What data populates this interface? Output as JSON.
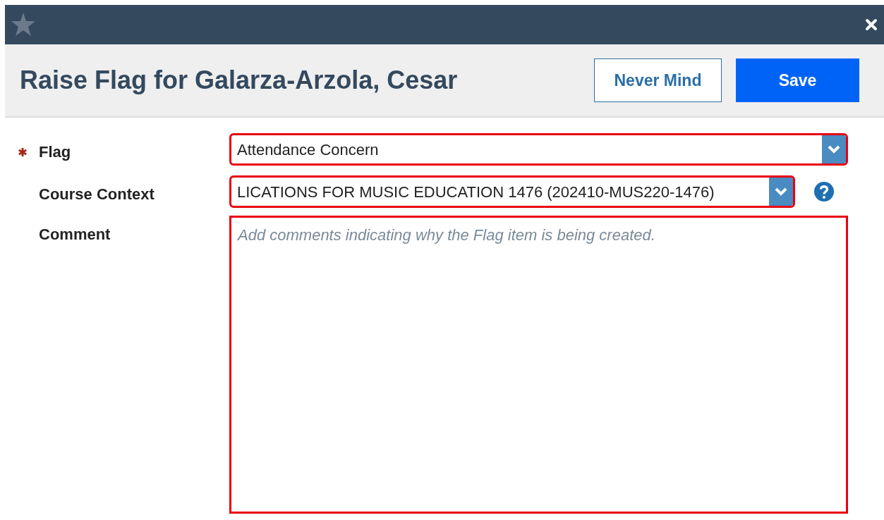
{
  "dialog": {
    "title": "Raise Flag for Galarza-Arzola, Cesar",
    "buttons": [
      {
        "kind": "secondary",
        "label": "Never Mind"
      },
      {
        "kind": "primary",
        "label": "Save"
      }
    ]
  },
  "fields": [
    {
      "kind": "select",
      "label": "Flag",
      "required": true,
      "value": "Attendance Concern",
      "help": false
    },
    {
      "kind": "select",
      "label": "Course Context",
      "required": false,
      "value": "LICATIONS FOR MUSIC EDUCATION 1476 (202410-MUS220-1476)",
      "help": true
    },
    {
      "kind": "textarea",
      "label": "Comment",
      "required": false,
      "placeholder": "Add comments indicating why the Flag item is being created.",
      "help": false
    }
  ]
}
